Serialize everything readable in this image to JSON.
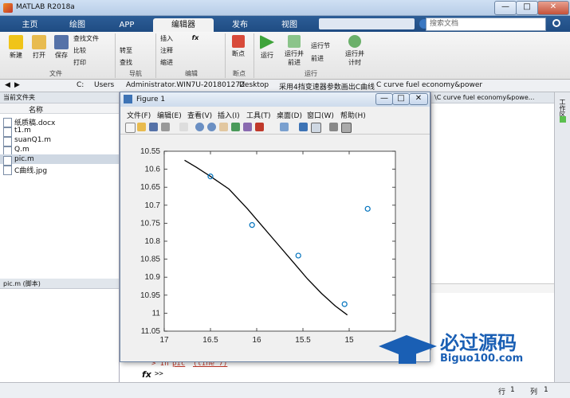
{
  "window": {
    "title": "MATLAB R2018a",
    "minimize": "—",
    "maximize": "□",
    "close": "✕"
  },
  "tabs": [
    {
      "label": "主页"
    },
    {
      "label": "绘图"
    },
    {
      "label": "APP"
    },
    {
      "label": "编辑器"
    },
    {
      "label": "发布"
    },
    {
      "label": "视图"
    }
  ],
  "search": {
    "placeholder": "搜索文档"
  },
  "ribbon": {
    "file_group": "文件",
    "nav_group": "导航",
    "edit_group": "编辑",
    "bp_group": "断点",
    "run_group": "运行",
    "new": "新建",
    "open": "打开",
    "save": "保存",
    "find_files": "查找文件",
    "compare": "比较",
    "print": "打印",
    "goto": "转至",
    "find": "查找",
    "insert": "插入",
    "comment": "注释",
    "indent": "缩进",
    "breakpoints": "断点",
    "run": "运行",
    "run_advance": "运行并\n前进",
    "run_section": "运行节",
    "advance": "前进",
    "run_time": "运行并\n计时",
    "fx": "fx"
  },
  "address": {
    "parts": [
      "C:",
      "Users",
      "Administrator.WIN7U-20180127Z",
      "Desktop",
      "采用4挡变速器参数画出C曲线",
      "C curve fuel economy&power"
    ]
  },
  "left_panel": {
    "title": "当前文件夹",
    "col_name": "名称",
    "files": [
      "纸质稿.docx",
      "t1.m",
      "suanQ1.m",
      "Q.m",
      "pic.m",
      "C曲线.jpg"
    ],
    "detail": "pic.m  (脚本)"
  },
  "right_panel": {
    "path": "\\C curve fuel economy&powe...",
    "side_label": "工作区"
  },
  "figure": {
    "title": "Figure 1",
    "menu": [
      "文件(F)",
      "编辑(E)",
      "查看(V)",
      "插入(I)",
      "工具(T)",
      "桌面(D)",
      "窗口(W)",
      "帮助(H)"
    ]
  },
  "command": {
    "error_prefix": "> In",
    "error_func": "pic",
    "error_line": "(line 7)",
    "prompt": ">>"
  },
  "status": {
    "row_label": "行",
    "row": "1",
    "col_label": "列",
    "col": "1"
  },
  "watermark": {
    "text": "必过源码",
    "url": "Biguo100.com"
  },
  "chart_data": {
    "type": "line",
    "xlim": [
      17,
      14.5
    ],
    "ylim": [
      10.55,
      11.05
    ],
    "x_reversed": true,
    "y_reversed": true,
    "xticks": [
      17,
      16.5,
      16,
      15.5,
      15
    ],
    "yticks": [
      10.55,
      10.6,
      10.65,
      10.7,
      10.75,
      10.8,
      10.85,
      10.9,
      10.95,
      11,
      11.05
    ],
    "series": [
      {
        "style": "line",
        "color": "#000000",
        "x": [
          16.78,
          16.65,
          16.5,
          16.3,
          16.1,
          15.95,
          15.8,
          15.6,
          15.45,
          15.3,
          15.15,
          15.02
        ],
        "y": [
          10.575,
          10.595,
          10.62,
          10.655,
          10.71,
          10.755,
          10.8,
          10.86,
          10.905,
          10.945,
          10.98,
          11.005
        ]
      },
      {
        "style": "markers",
        "color": "#0072bd",
        "x": [
          16.5,
          16.05,
          15.55,
          15.05,
          14.8
        ],
        "y": [
          10.62,
          10.755,
          10.84,
          10.975,
          10.71
        ]
      }
    ]
  }
}
